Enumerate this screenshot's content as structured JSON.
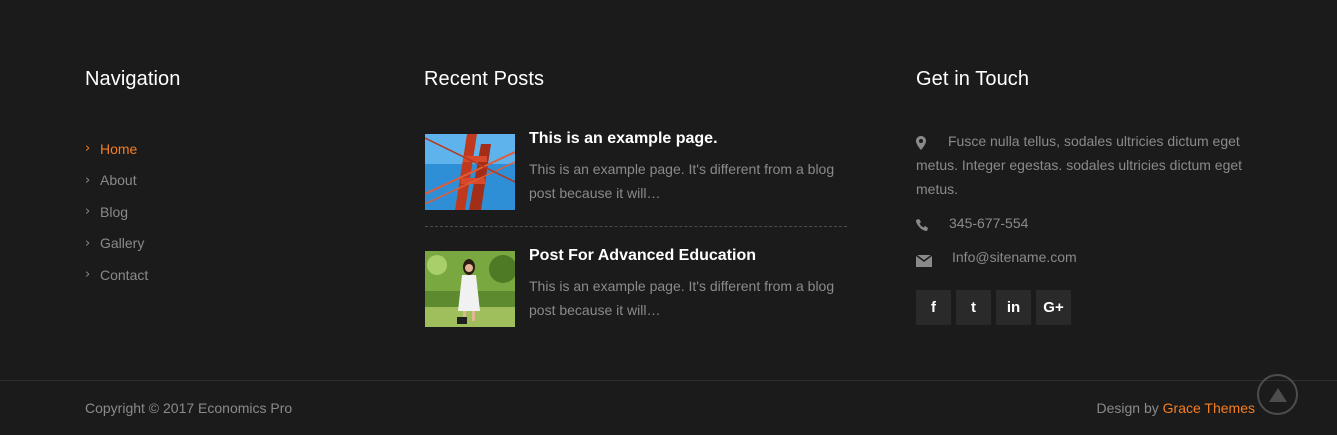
{
  "navigation": {
    "title": "Navigation",
    "items": [
      {
        "label": "Home"
      },
      {
        "label": "About"
      },
      {
        "label": "Blog"
      },
      {
        "label": "Gallery"
      },
      {
        "label": "Contact"
      }
    ]
  },
  "recent_posts": {
    "title": "Recent Posts",
    "posts": [
      {
        "title": "This is an example page.",
        "excerpt": "This is an example page. It's different from a blog post because it will…"
      },
      {
        "title": "Post For Advanced Education",
        "excerpt": "This is an example page. It's different from a blog post because it will…"
      }
    ]
  },
  "contact": {
    "title": "Get in Touch",
    "address": "Fusce nulla tellus, sodales ultricies dictum eget metus. Integer egestas. sodales ultricies dictum eget metus.",
    "phone": "345-677-554",
    "email": "Info@sitename.com",
    "social": [
      {
        "label": "f",
        "icon": "facebook-icon"
      },
      {
        "label": "t",
        "icon": "twitter-icon"
      },
      {
        "label": "in",
        "icon": "linkedin-icon"
      },
      {
        "label": "G+",
        "icon": "google-plus-icon"
      }
    ]
  },
  "footer": {
    "copyright": "Copyright © 2017 Economics Pro",
    "credit_prefix": "Design by",
    "credit_link": "Grace Themes"
  },
  "colors": {
    "background": "#1c1b1b",
    "accent": "#f47e20",
    "muted_text": "#8a8a8a",
    "heading": "#ffffff"
  }
}
